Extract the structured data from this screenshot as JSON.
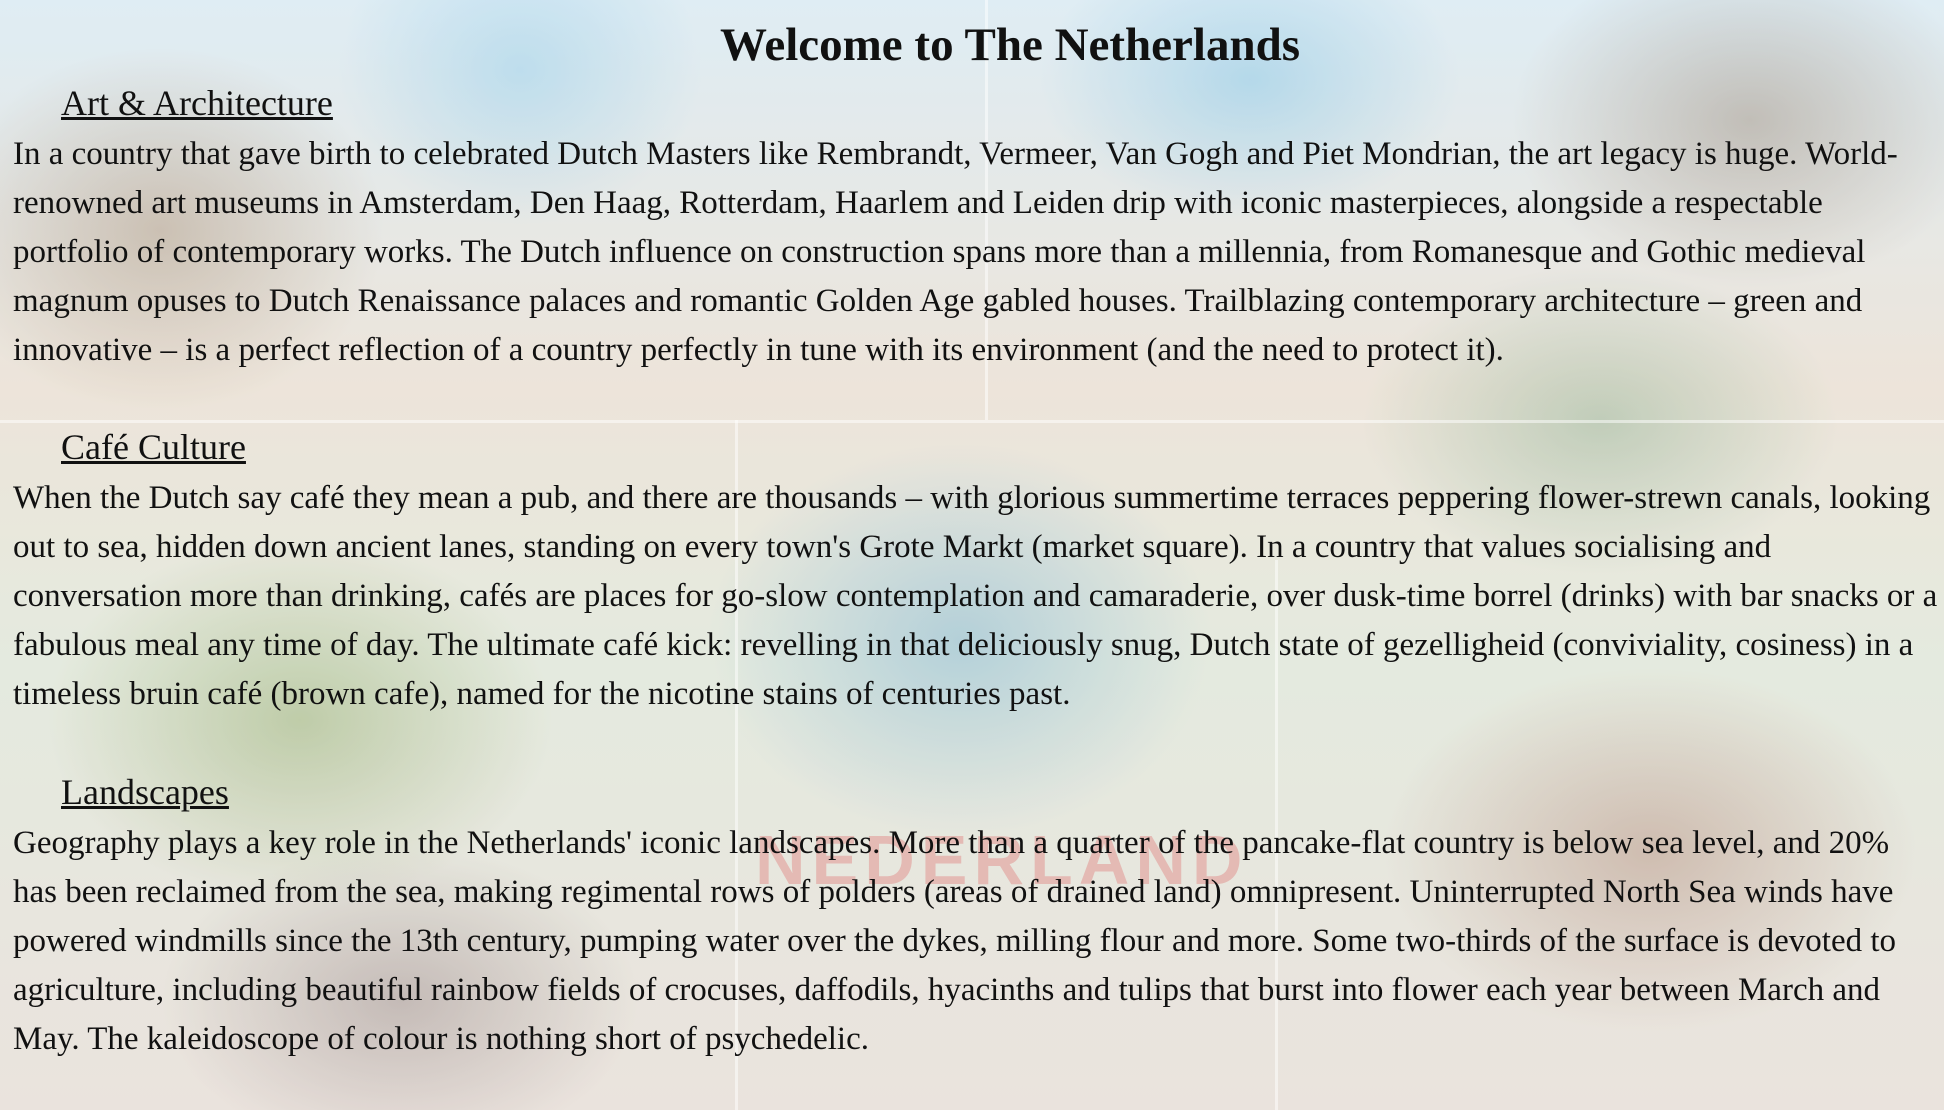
{
  "page": {
    "title": "Welcome to The Netherlands",
    "background_word": "NEDERLAND"
  },
  "sections": [
    {
      "heading": "Art & Architecture",
      "body": "In a country that gave birth to celebrated Dutch Masters like Rembrandt, Vermeer, Van Gogh and Piet Mondrian, the art legacy is huge. World-renowned art museums in Amsterdam, Den Haag, Rotterdam, Haarlem and Leiden drip with iconic masterpieces, alongside a respectable portfolio of contemporary works. The Dutch influence on construction spans more than a millennia, from Romanesque and Gothic medieval magnum opuses to Dutch Renaissance palaces and romantic Golden Age gabled houses. Trailblazing contemporary architecture – green and innovative – is a perfect reflection of a country perfectly in tune with its environment (and the need to protect it)."
    },
    {
      "heading": "Café Culture",
      "body": "When the Dutch say café they mean a pub, and there are thousands – with glorious summertime terraces peppering flower-strewn canals, looking out to sea, hidden down ancient lanes, standing on every town's Grote Markt (market square). In a country that values socialising and conversation more than drinking, cafés are places for go-slow contemplation and camaraderie, over dusk-time borrel (drinks) with bar snacks or a fabulous meal any time of day. The ultimate café kick: revelling in that deliciously snug, Dutch state of gezelligheid (conviviality, cosiness) in a timeless bruin café (brown cafe), named for the nicotine stains of centuries past."
    },
    {
      "heading": "Landscapes",
      "body": "Geography plays a key role in the Netherlands' iconic landscapes. More than a quarter of the pancake-flat country is below sea level, and 20% has been reclaimed from the sea, making regimental rows of polders (areas of drained land) omnipresent. Uninterrupted North Sea winds have powered windmills since the 13th century, pumping water over the dykes, milling flour and more. Some two-thirds of the surface is devoted to agriculture, including beautiful rainbow fields of crocuses, daffodils, hyacinths and tulips that burst into flower each year between March and May. The kaleidoscope of colour is nothing short of psychedelic."
    }
  ]
}
